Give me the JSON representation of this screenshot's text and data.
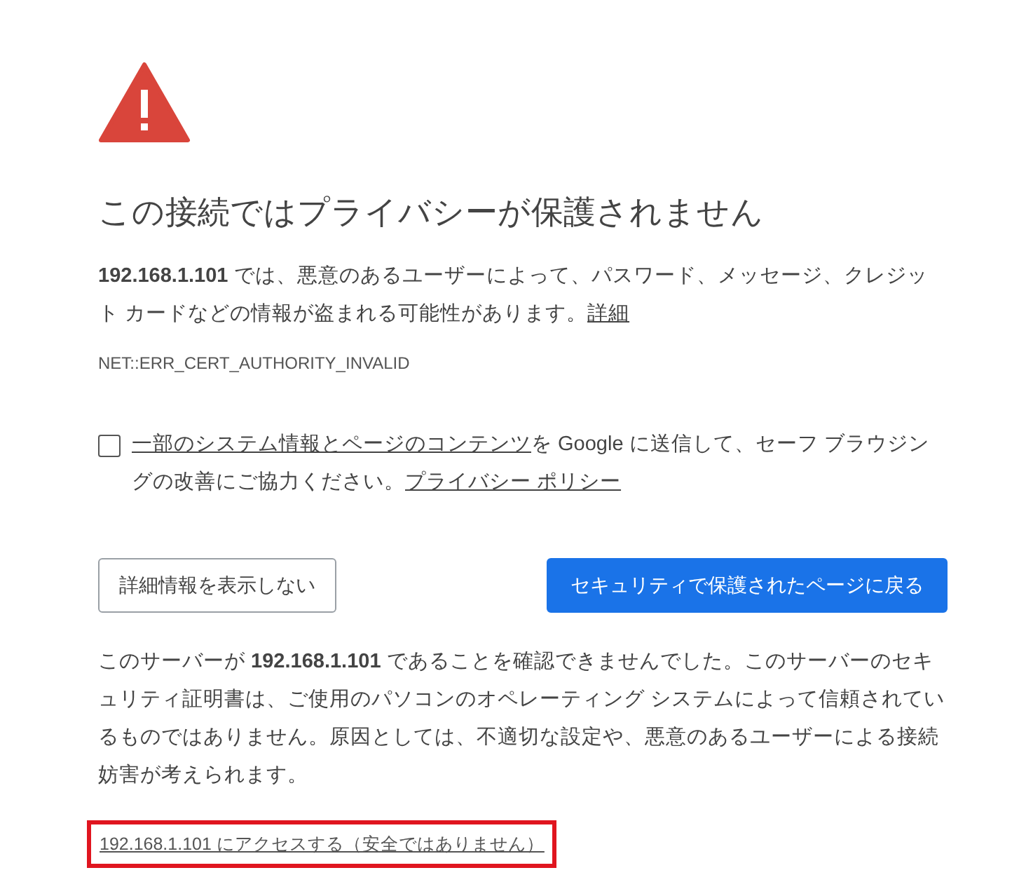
{
  "heading": "この接続ではプライバシーが保護されません",
  "summary": {
    "text": "**192.168.1.101** では、悪意のあるユーザーによって、パスワード、メッセージ、クレジット カードなどの情報が盗まれる可能性があります。",
    "link": "詳細"
  },
  "error_code": "NET::ERR_CERT_AUTHORITY_INVALID",
  "opt_in": {
    "checked": false,
    "link": "一部のシステム情報とページのコンテンツ",
    "text": "を Google に送信して、セーフ ブラウジングの改善にご協力ください。",
    "policy_link": "プライバシー ポリシー"
  },
  "buttons": [
    {
      "label": "詳細情報を表示しない",
      "kind": "secondary"
    },
    {
      "label": "セキュリティで保護されたページに戻る",
      "kind": "primary"
    }
  ],
  "details": "このサーバーが **192.168.1.101** であることを確認できませんでした。このサーバーのセキュリティ証明書は、ご使用のパソコンのオペレーティング システムによって信頼されているものではありません。原因としては、不適切な設定や、悪意のあるユーザーによる接続妨害が考えられます。",
  "proceed_link": {
    "label": "192.168.1.101 にアクセスする（安全ではありません）",
    "highlighted": true
  }
}
